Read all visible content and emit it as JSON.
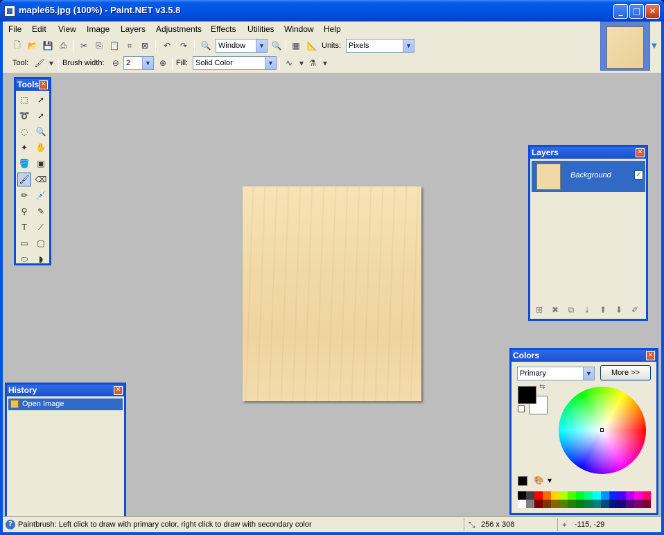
{
  "window": {
    "title": "maple65.jpg (100%) - Paint.NET v3.5.8"
  },
  "menu": [
    "File",
    "Edit",
    "View",
    "Image",
    "Layers",
    "Adjustments",
    "Effects",
    "Utilities",
    "Window",
    "Help"
  ],
  "toolbar": {
    "zoom_value": "Window",
    "units_label": "Units:",
    "units_value": "Pixels",
    "tool_label": "Tool:",
    "brush_width_label": "Brush width:",
    "brush_width_value": "2",
    "fill_label": "Fill:",
    "fill_value": "Solid Color"
  },
  "panels": {
    "tools_title": "Tools",
    "layers_title": "Layers",
    "layer_name": "Background",
    "history_title": "History",
    "history_item": "Open Image",
    "colors_title": "Colors",
    "colors_mode": "Primary",
    "more_button": "More >>"
  },
  "colors": {
    "primary": "#000000",
    "secondary": "#ffffff",
    "palette": [
      "#000000",
      "#404040",
      "#ff0000",
      "#ff6a00",
      "#ffd800",
      "#b6ff00",
      "#4cff00",
      "#00ff21",
      "#00ff90",
      "#00ffff",
      "#0094ff",
      "#0026ff",
      "#4800ff",
      "#b200ff",
      "#ff00dc",
      "#ff006e",
      "#ffffff",
      "#808080",
      "#7f0000",
      "#7f3300",
      "#7f6a00",
      "#5b7f00",
      "#267f00",
      "#007f0e",
      "#007f46",
      "#007f7f",
      "#004a7f",
      "#00137f",
      "#21007f",
      "#57007f",
      "#7f006e",
      "#7f0037"
    ]
  },
  "status": {
    "hint": "Paintbrush: Left click to draw with primary color, right click to draw with secondary color",
    "image_size": "256 x 308",
    "cursor_pos": "-115, -29"
  }
}
